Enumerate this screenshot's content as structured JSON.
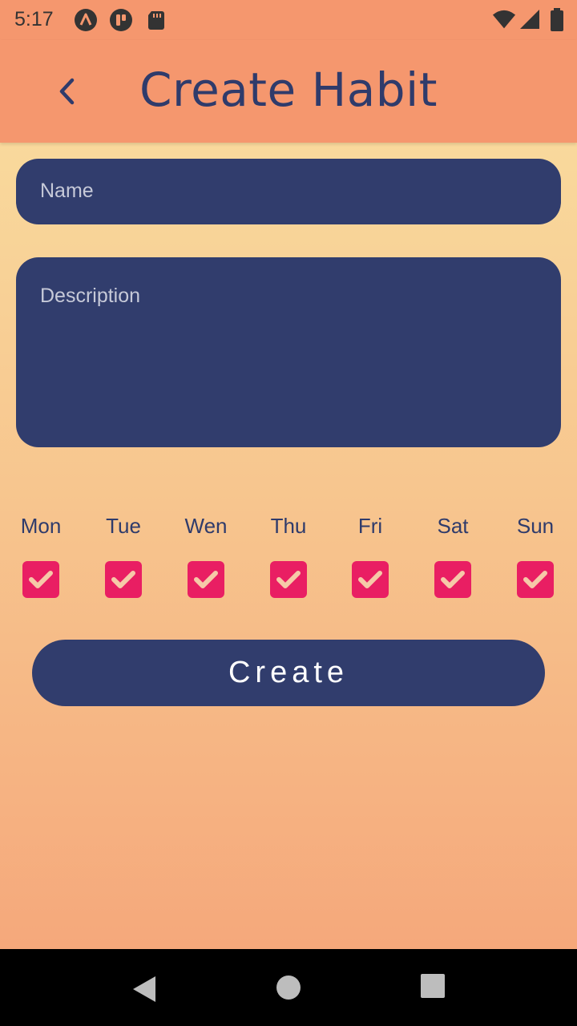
{
  "status_bar": {
    "time": "5:17",
    "left_icons": [
      "a-logo-icon",
      "p-logo-icon",
      "sd-card-icon"
    ],
    "right_icons": [
      "wifi-icon",
      "signal-icon",
      "battery-icon"
    ]
  },
  "app_bar": {
    "back_icon": "chevron-left-icon",
    "title": "Create Habit"
  },
  "form": {
    "name": {
      "placeholder": "Name",
      "value": ""
    },
    "description": {
      "placeholder": "Description",
      "value": ""
    },
    "days": [
      {
        "label": "Mon",
        "checked": true
      },
      {
        "label": "Tue",
        "checked": true
      },
      {
        "label": "Wen",
        "checked": true
      },
      {
        "label": "Thu",
        "checked": true
      },
      {
        "label": "Fri",
        "checked": true
      },
      {
        "label": "Sat",
        "checked": true
      },
      {
        "label": "Sun",
        "checked": true
      }
    ],
    "create_label": "Create"
  },
  "nav_bar": {
    "icons": [
      "back-triangle-icon",
      "home-circle-icon",
      "recents-square-icon"
    ]
  },
  "colors": {
    "accent": "#e91e63",
    "primary_dark": "#313d6d",
    "app_bar": "#f5976e"
  }
}
